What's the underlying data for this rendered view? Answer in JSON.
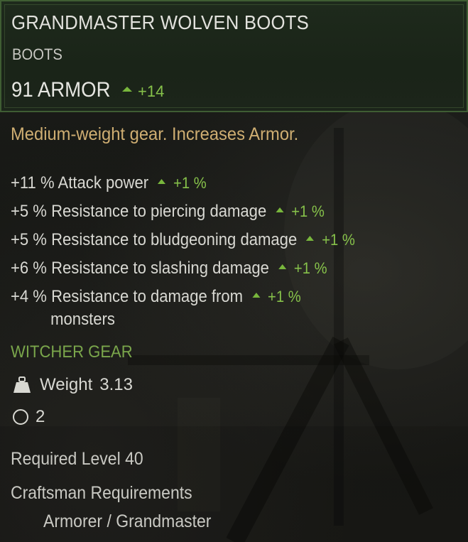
{
  "item": {
    "name": "GRANDMASTER WOLVEN BOOTS",
    "type": "BOOTS",
    "armor_text": "91 ARMOR",
    "armor_delta": "+14",
    "description": "Medium-weight gear. Increases Armor."
  },
  "stats": [
    {
      "text": "+11 % Attack power",
      "delta": "+1 %"
    },
    {
      "text": "+5 % Resistance to piercing damage",
      "delta": "+1 %"
    },
    {
      "text": "+5 % Resistance to bludgeoning damage",
      "delta": "+1 %"
    },
    {
      "text": "+6 % Resistance to slashing damage",
      "delta": "+1 %"
    },
    {
      "text": "+4 % Resistance to damage from",
      "continuation": "monsters",
      "delta": "+1 %"
    }
  ],
  "gear_set": "WITCHER GEAR",
  "weight": {
    "icon": "weight-icon",
    "label": "Weight",
    "value": "3.13"
  },
  "sockets": {
    "icon": "socket-icon",
    "count": "2"
  },
  "required_level": "Required Level 40",
  "craftsman": {
    "title": "Craftsman Requirements",
    "value": "Armorer / Grandmaster"
  },
  "colors": {
    "header_border": "#3f5d33",
    "description": "#cfae72",
    "positive": "#86c14a",
    "gear_set": "#7aa64b",
    "text": "#d8d8d2"
  }
}
